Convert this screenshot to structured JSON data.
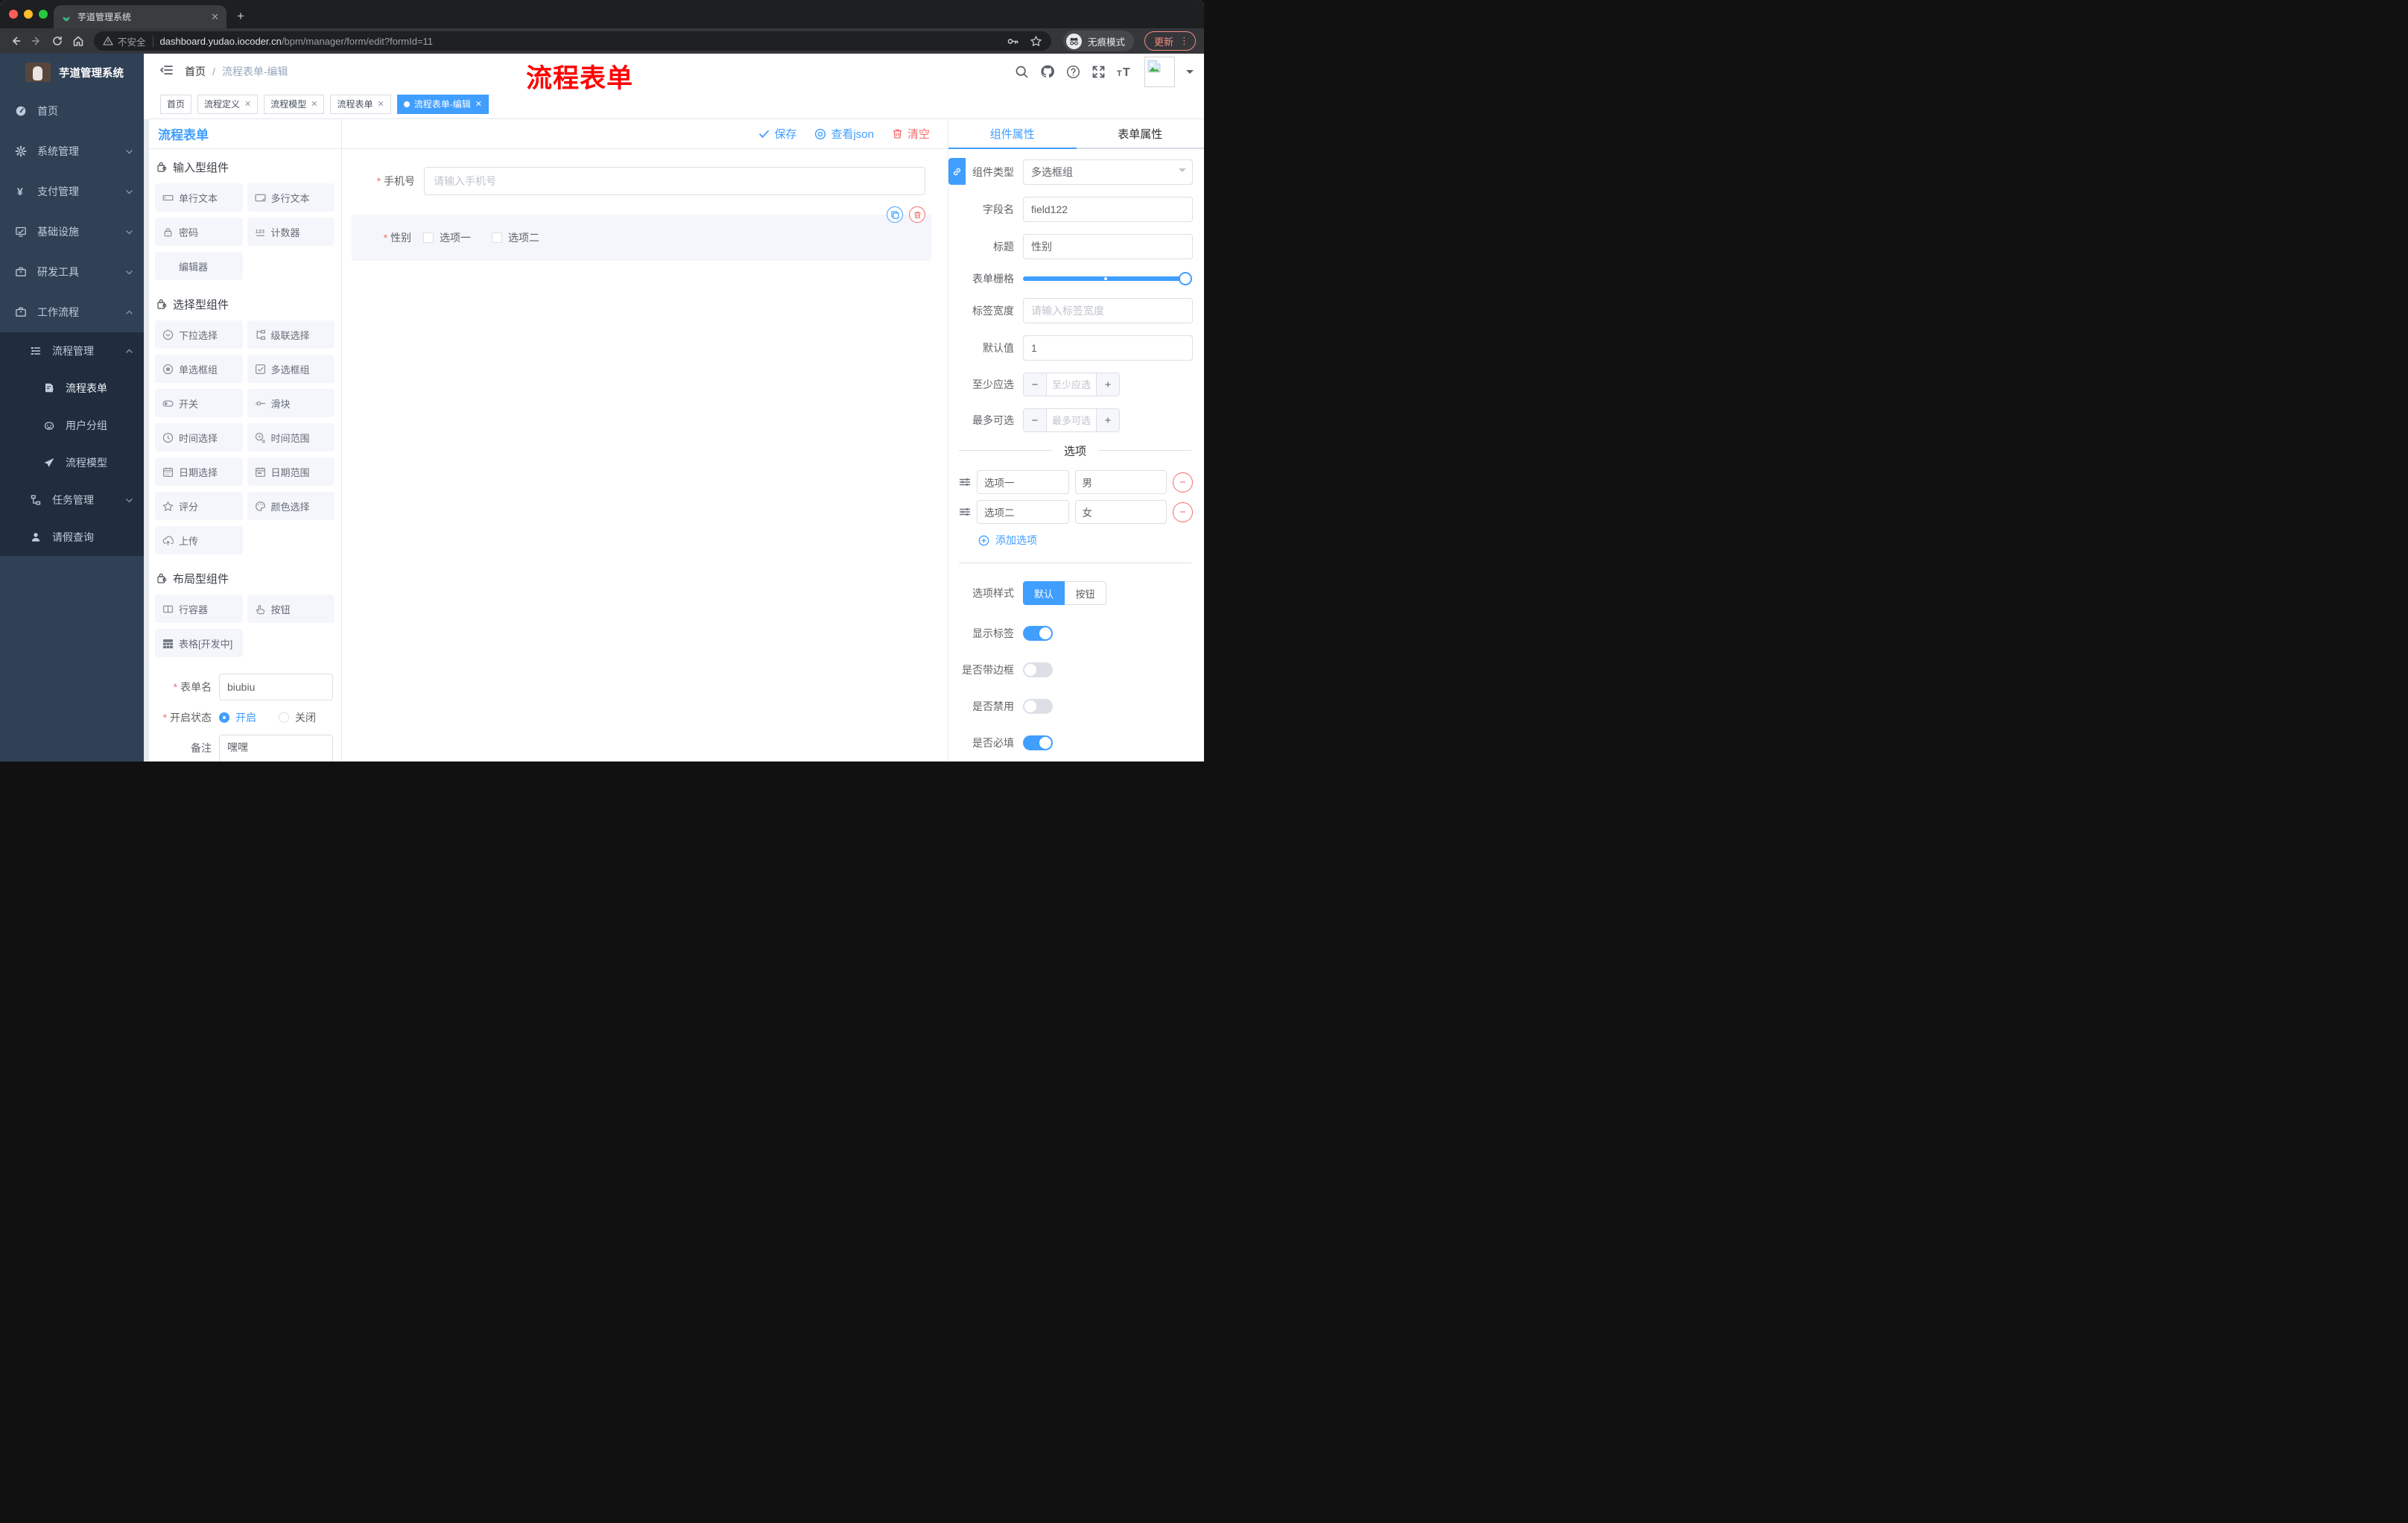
{
  "browser": {
    "tab_title": "芋道管理系统",
    "security_label": "不安全",
    "url_host": "dashboard.yudao.iocoder.cn",
    "url_path": "/bpm/manager/form/edit?formId=11",
    "incognito_label": "无痕模式",
    "update_label": "更新"
  },
  "sidebar": {
    "brand": "芋道管理系统",
    "items": [
      {
        "label": "首页",
        "icon": "dashboard-icon"
      },
      {
        "label": "系统管理",
        "icon": "gear-icon"
      },
      {
        "label": "支付管理",
        "icon": "yen-icon"
      },
      {
        "label": "基础设施",
        "icon": "monitor-icon"
      },
      {
        "label": "研发工具",
        "icon": "toolbox-icon"
      },
      {
        "label": "工作流程",
        "icon": "briefcase-icon"
      },
      {
        "label": "流程管理",
        "icon": "flow-list-icon"
      },
      {
        "label": "流程表单",
        "icon": "document-edit-icon"
      },
      {
        "label": "用户分组",
        "icon": "robot-icon"
      },
      {
        "label": "流程模型",
        "icon": "paper-plane-icon"
      },
      {
        "label": "任务管理",
        "icon": "tree-icon"
      },
      {
        "label": "请假查询",
        "icon": "user-icon"
      }
    ]
  },
  "header": {
    "breadcrumb_home": "首页",
    "breadcrumb_sep": "/",
    "breadcrumb_current": "流程表单-编辑",
    "annotation": "流程表单"
  },
  "tags": [
    {
      "label": "首页"
    },
    {
      "label": "流程定义"
    },
    {
      "label": "流程模型"
    },
    {
      "label": "流程表单"
    },
    {
      "label": "流程表单-编辑"
    }
  ],
  "panel_title": "流程表单",
  "toolbar": {
    "save": "保存",
    "view_json": "查看json",
    "clear": "清空"
  },
  "palette": {
    "sections": [
      {
        "title": "输入型组件",
        "items": [
          {
            "label": "单行文本",
            "icon": "text-input-icon"
          },
          {
            "label": "多行文本",
            "icon": "textarea-icon"
          },
          {
            "label": "密码",
            "icon": "lock-icon"
          },
          {
            "label": "计数器",
            "icon": "counter-icon"
          },
          {
            "label": "编辑器",
            "icon": "none"
          }
        ]
      },
      {
        "title": "选择型组件",
        "items": [
          {
            "label": "下拉选择",
            "icon": "select-icon"
          },
          {
            "label": "级联选择",
            "icon": "cascader-icon"
          },
          {
            "label": "单选框组",
            "icon": "radio-icon"
          },
          {
            "label": "多选框组",
            "icon": "checkbox-icon"
          },
          {
            "label": "开关",
            "icon": "switch-icon"
          },
          {
            "label": "滑块",
            "icon": "slider-icon"
          },
          {
            "label": "时间选择",
            "icon": "time-icon"
          },
          {
            "label": "时间范围",
            "icon": "time-range-icon"
          },
          {
            "label": "日期选择",
            "icon": "date-icon"
          },
          {
            "label": "日期范围",
            "icon": "date-range-icon"
          },
          {
            "label": "评分",
            "icon": "star-icon"
          },
          {
            "label": "颜色选择",
            "icon": "palette-icon"
          },
          {
            "label": "上传",
            "icon": "upload-icon"
          }
        ]
      },
      {
        "title": "布局型组件",
        "items": [
          {
            "label": "行容器",
            "icon": "row-icon"
          },
          {
            "label": "按钮",
            "icon": "button-icon"
          },
          {
            "label": "表格[开发中]",
            "icon": "table-icon"
          }
        ]
      }
    ]
  },
  "form_settings": {
    "name_label": "表单名",
    "name_value": "biubiu",
    "status_label": "开启状态",
    "status_on": "开启",
    "status_off": "关闭",
    "status_selected": "开启",
    "remark_label": "备注",
    "remark_value": "嘿嘿"
  },
  "canvas": {
    "phone": {
      "label": "手机号",
      "placeholder": "请输入手机号",
      "required": true
    },
    "gender": {
      "label": "性别",
      "required": true,
      "option1": "选项一",
      "option2": "选项二"
    }
  },
  "props": {
    "tabs": [
      "组件属性",
      "表单属性"
    ],
    "active_tab": "组件属性",
    "component_type_label": "组件类型",
    "component_type_value": "多选框组",
    "field_name_label": "字段名",
    "field_name_value": "field122",
    "title_label": "标题",
    "title_value": "性别",
    "grid_label": "表单栅格",
    "label_width_label": "标签宽度",
    "label_width_placeholder": "请输入标签宽度",
    "default_label": "默认值",
    "default_value": "1",
    "min_label": "至少应选",
    "min_placeholder": "至少应选",
    "max_label": "最多可选",
    "max_placeholder": "最多可选",
    "options_title": "选项",
    "options": [
      {
        "name": "选项一",
        "value": "男"
      },
      {
        "name": "选项二",
        "value": "女"
      }
    ],
    "add_option": "添加选项",
    "style_label": "选项样式",
    "style_options": [
      "默认",
      "按钮"
    ],
    "style_selected": "默认",
    "switches": [
      {
        "label": "显示标签",
        "on": true
      },
      {
        "label": "是否带边框",
        "on": false
      },
      {
        "label": "是否禁用",
        "on": false
      },
      {
        "label": "是否必填",
        "on": true
      }
    ]
  },
  "colors": {
    "accent": "#409eff",
    "danger": "#f56c6c",
    "sidebar_bg": "#304156",
    "submenu_bg": "#1f2d3d",
    "annotation_red": "#fe0000",
    "update_red": "#f28b82"
  }
}
